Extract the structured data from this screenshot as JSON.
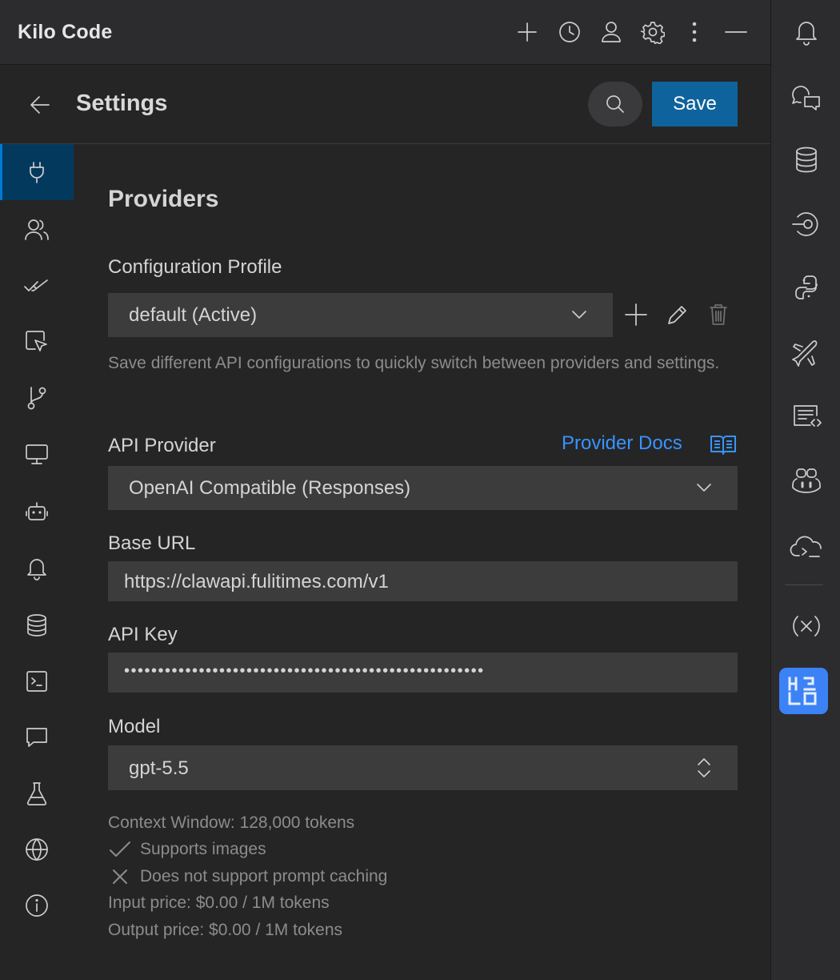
{
  "app": {
    "title": "Kilo Code"
  },
  "settings": {
    "title": "Settings",
    "save_label": "Save"
  },
  "providers": {
    "section_title": "Providers",
    "config_profile": {
      "label": "Configuration Profile",
      "value": "default (Active)",
      "hint": "Save different API configurations to quickly switch between providers and settings."
    },
    "api_provider": {
      "label": "API Provider",
      "value": "OpenAI Compatible (Responses)",
      "docs_label": "Provider Docs"
    },
    "base_url": {
      "label": "Base URL",
      "value": "https://clawapi.fulitimes.com/v1"
    },
    "api_key": {
      "label": "API Key",
      "value": "•••••••••••••••••••••••••••••••••••••••••••••••••••••"
    },
    "model": {
      "label": "Model",
      "value": "gpt-5.5"
    },
    "model_info": {
      "context_window": "Context Window: 128,000 tokens",
      "supports_images": "Supports images",
      "prompt_caching": "Does not support prompt caching",
      "input_price": "Input price: $0.00 / 1M tokens",
      "output_price": "Output price: $0.00 / 1M tokens"
    }
  },
  "colors": {
    "accent": "#0e639c",
    "link": "#3794ff",
    "active_nav": "#04395e",
    "kilo_badge": "#3b82f6"
  },
  "icons": {
    "topbar": [
      "plus-icon",
      "history-icon",
      "account-icon",
      "gear-icon",
      "more-icon",
      "minimize-icon"
    ],
    "leftnav": [
      "plug-icon",
      "users-icon",
      "check-all-icon",
      "cursor-icon",
      "git-branch-icon",
      "monitor-icon",
      "robot-icon",
      "bell-icon",
      "database-icon",
      "terminal-icon",
      "chat-icon",
      "flask-icon",
      "globe-icon",
      "info-icon"
    ],
    "rightbar": [
      "bell-icon",
      "chat-code-icon",
      "database-icon",
      "target-icon",
      "python-icon",
      "airplane-icon",
      "code-review-icon",
      "copilot-icon",
      "cloud-terminal-icon",
      "variables-icon",
      "kilo-icon"
    ]
  }
}
